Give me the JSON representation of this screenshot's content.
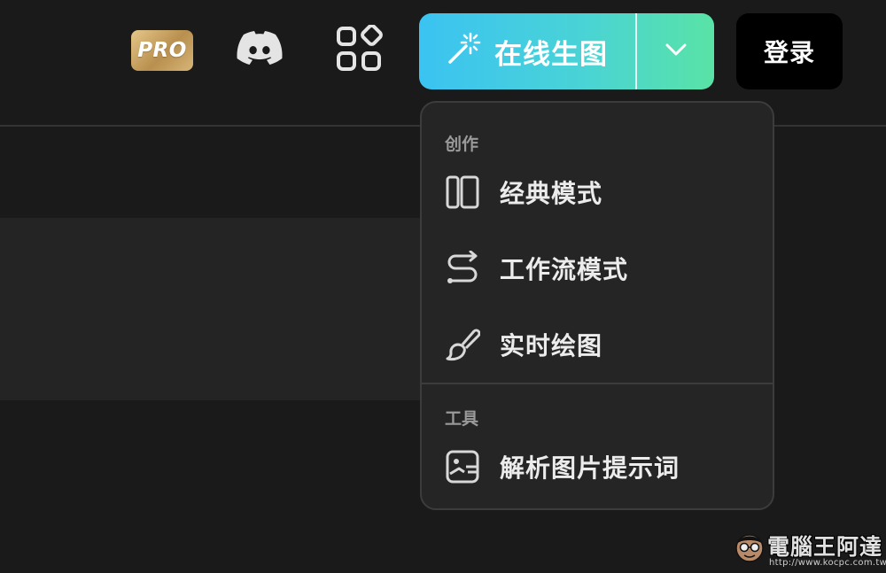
{
  "header": {
    "pro_badge": "PRO",
    "discord_icon": "discord-icon",
    "apps_icon": "apps-grid-icon",
    "create_button": {
      "icon": "magic-wand-icon",
      "label": "在线生图",
      "caret_icon": "chevron-down-icon"
    },
    "login_label": "登录"
  },
  "dropdown": {
    "sections": [
      {
        "title": "创作",
        "items": [
          {
            "icon": "columns-layout-icon",
            "label": "经典模式"
          },
          {
            "icon": "workflow-route-icon",
            "label": "工作流模式"
          },
          {
            "icon": "paint-brush-icon",
            "label": "实时绘图"
          }
        ]
      },
      {
        "title": "工具",
        "items": [
          {
            "icon": "image-prompt-icon",
            "label": "解析图片提示词"
          }
        ]
      }
    ]
  },
  "watermark": {
    "title": "電腦王阿達",
    "url": "http://www.kocpc.com.tw"
  },
  "colors": {
    "background": "#1a1a1a",
    "panel": "#242424",
    "dropdown_bg": "#252525",
    "accent_gradient_start": "#3bc3f2",
    "accent_gradient_end": "#59e3a6",
    "pro_gold": "#c9a264",
    "login_bg": "#000000"
  }
}
